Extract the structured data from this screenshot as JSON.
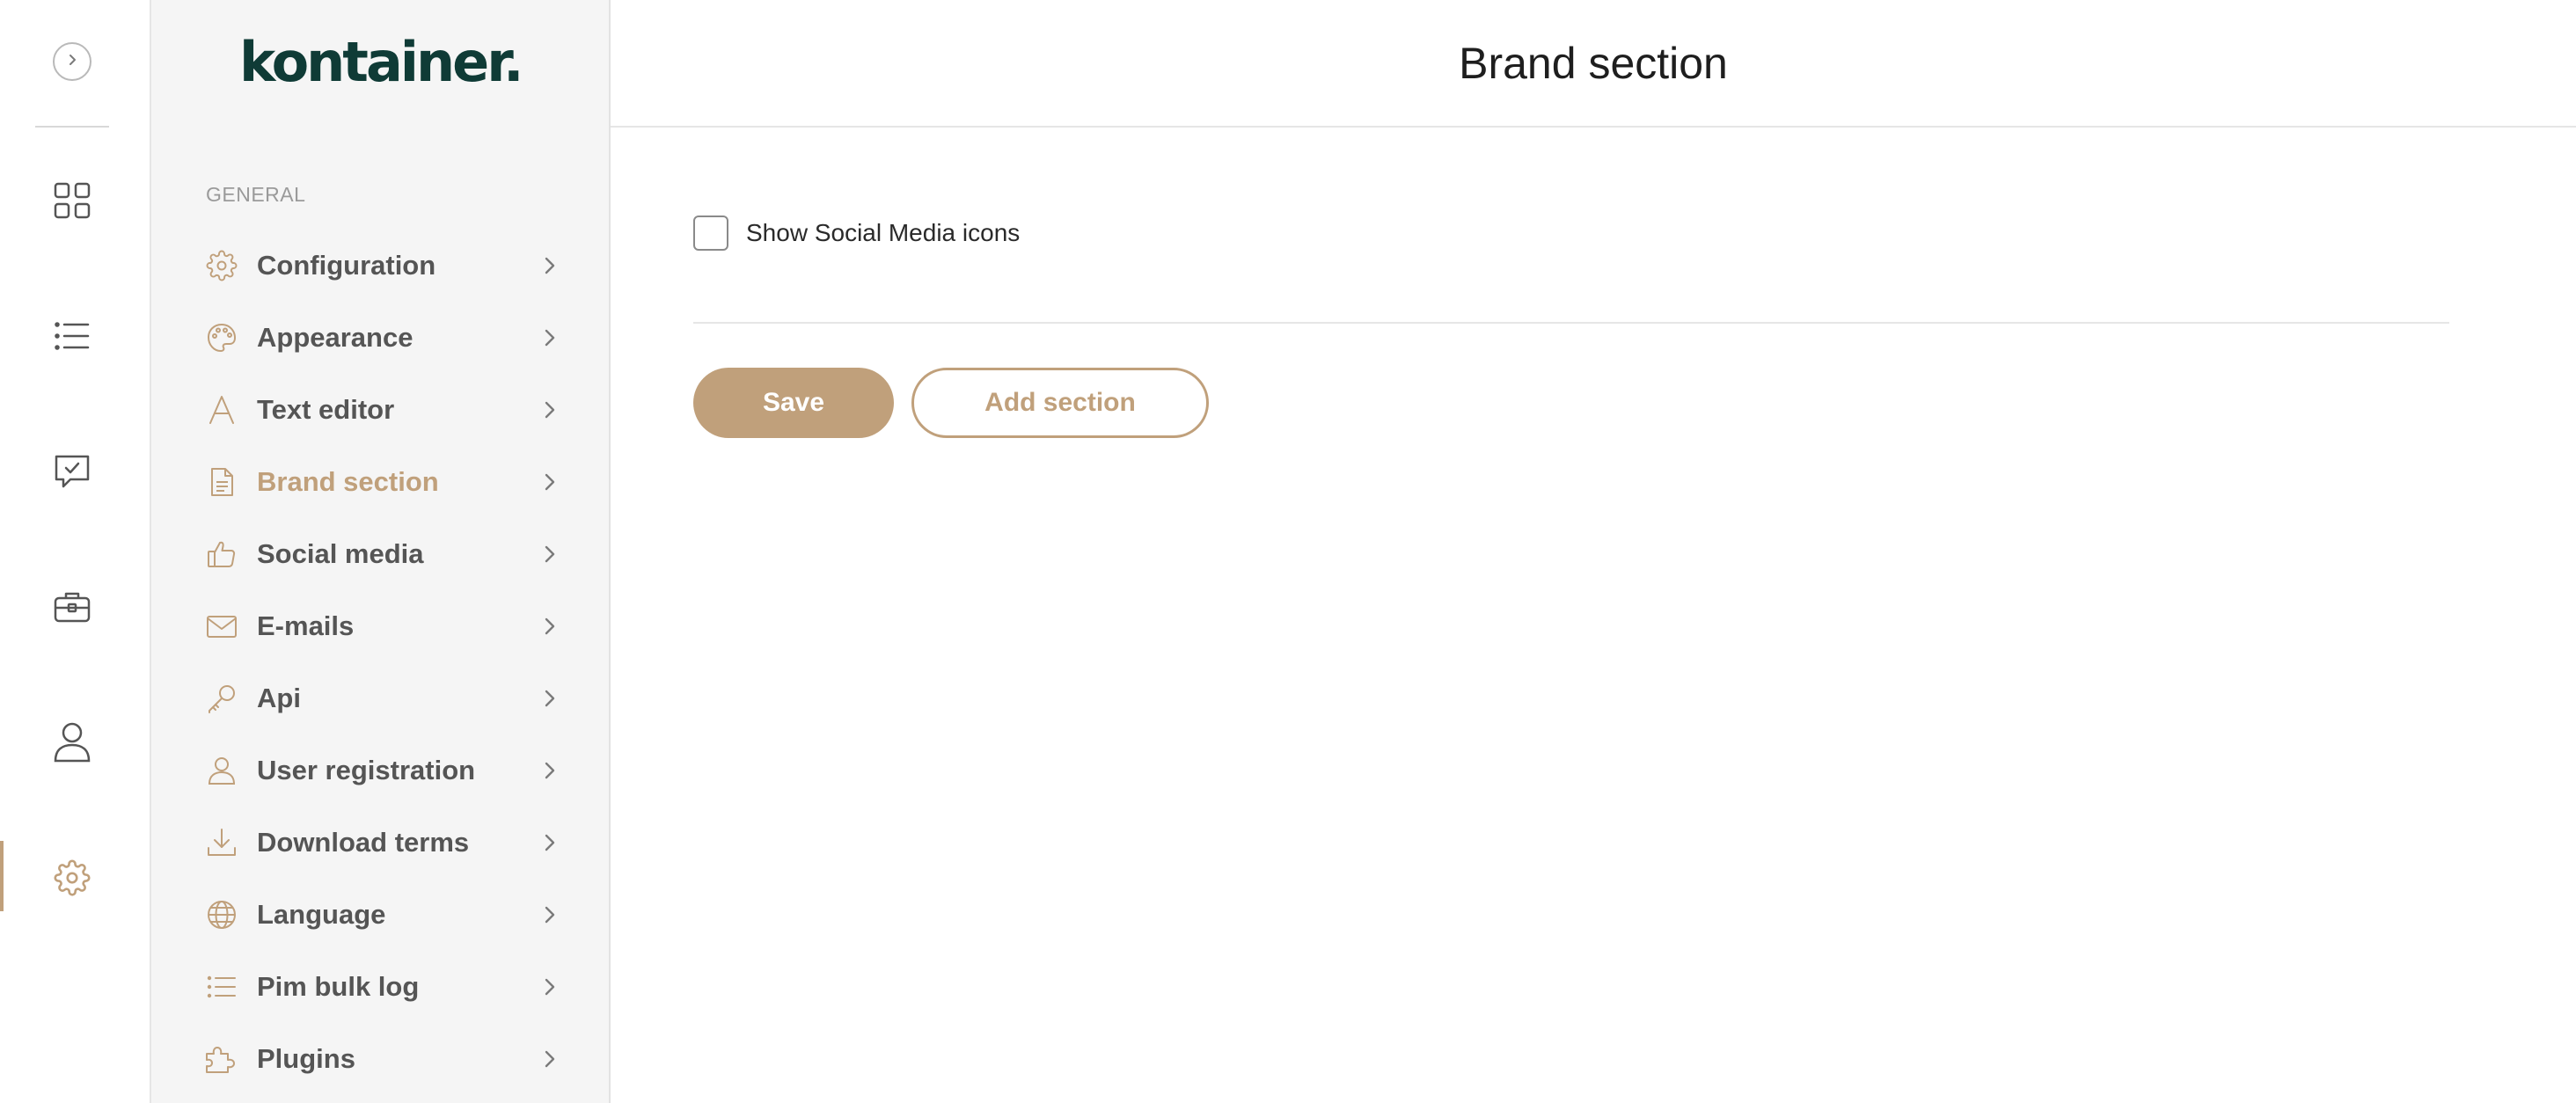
{
  "app": {
    "logo_text": "kontainer."
  },
  "colors": {
    "accent": "#c0a07b",
    "logo": "#0f3b36",
    "nav_text": "#555555"
  },
  "rail": {
    "items": [
      {
        "icon": "grid-icon"
      },
      {
        "icon": "list-icon"
      },
      {
        "icon": "message-check-icon"
      },
      {
        "icon": "briefcase-icon"
      },
      {
        "icon": "user-icon"
      },
      {
        "icon": "gear-icon",
        "active": true
      }
    ]
  },
  "sidebar": {
    "section_label": "GENERAL",
    "items": [
      {
        "label": "Configuration",
        "icon": "gear-icon"
      },
      {
        "label": "Appearance",
        "icon": "palette-icon"
      },
      {
        "label": "Text editor",
        "icon": "text-icon"
      },
      {
        "label": "Brand section",
        "icon": "document-icon",
        "active": true
      },
      {
        "label": "Social media",
        "icon": "thumbs-up-icon"
      },
      {
        "label": "E-mails",
        "icon": "mail-icon"
      },
      {
        "label": "Api",
        "icon": "key-icon"
      },
      {
        "label": "User registration",
        "icon": "user-icon"
      },
      {
        "label": "Download terms",
        "icon": "download-icon"
      },
      {
        "label": "Language",
        "icon": "globe-icon"
      },
      {
        "label": "Pim bulk log",
        "icon": "list-icon"
      },
      {
        "label": "Plugins",
        "icon": "puzzle-icon"
      }
    ]
  },
  "main": {
    "title": "Brand section",
    "checkbox": {
      "label": "Show Social Media icons",
      "checked": false
    },
    "save_label": "Save",
    "add_section_label": "Add section"
  }
}
